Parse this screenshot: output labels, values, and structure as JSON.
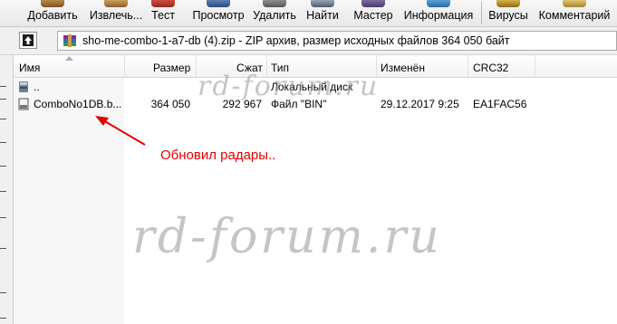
{
  "toolbar": {
    "buttons": [
      {
        "label": "Добавить",
        "icon": "add-icon"
      },
      {
        "label": "Извлечь...",
        "icon": "extract-icon"
      },
      {
        "label": "Тест",
        "icon": "test-icon"
      },
      {
        "label": "Просмотр",
        "icon": "view-icon"
      },
      {
        "label": "Удалить",
        "icon": "delete-icon"
      },
      {
        "label": "Найти",
        "icon": "find-icon"
      },
      {
        "label": "Мастер",
        "icon": "wizard-icon"
      },
      {
        "label": "Информация",
        "icon": "info-icon"
      },
      {
        "label": "Вирусы",
        "icon": "virus-icon"
      },
      {
        "label": "Комментарий",
        "icon": "comment-icon"
      }
    ]
  },
  "addressbar": {
    "path_text": "sho-me-combo-1-a7-db (4).zip - ZIP архив, размер исходных файлов 364 050 байт"
  },
  "filelist": {
    "columns": [
      "Имя",
      "Размер",
      "Сжат",
      "Тип",
      "Изменён",
      "CRC32"
    ],
    "rows": [
      {
        "name": "..",
        "size": "",
        "packed": "",
        "type": "Локальный диск",
        "modified": "",
        "crc": ""
      },
      {
        "name": "ComboNo1DB.b...",
        "size": "364 050",
        "packed": "292 967",
        "type": "Файл \"BIN\"",
        "modified": "29.12.2017 9:25",
        "crc": "EA1FAC56"
      }
    ]
  },
  "annotation": {
    "text": "Обновил радары..",
    "color": "#e60000"
  },
  "watermarks": {
    "small": "rd-forum.ru",
    "big": "rd-forum.ru"
  }
}
